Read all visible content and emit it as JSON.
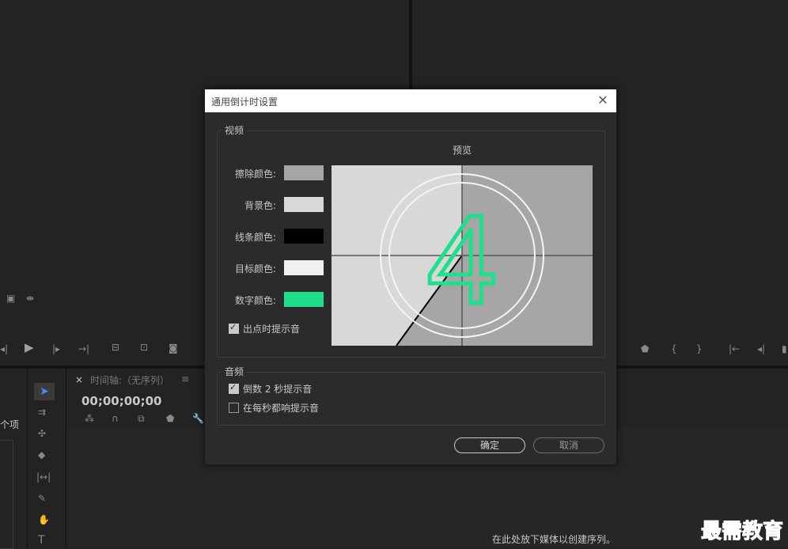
{
  "dialog": {
    "title": "通用倒计时设置",
    "video_group": "视频",
    "preview_label": "预览",
    "rows": [
      {
        "label": "擦除颜色:",
        "color": "#a6a6a6"
      },
      {
        "label": "背景色:",
        "color": "#d8d8d8"
      },
      {
        "label": "线条颜色:",
        "color": "#000000"
      },
      {
        "label": "目标颜色:",
        "color": "#f0f0f0"
      },
      {
        "label": "数字颜色:",
        "color": "#1ee08a"
      }
    ],
    "cue_at_out": "出点时提示音",
    "audio_group": "音频",
    "cue_2sec": "倒数 2 秒提示音",
    "cue_every_sec": "在每秒都响提示音",
    "ok": "确定",
    "cancel": "取消",
    "preview_number": "4"
  },
  "timeline": {
    "tab_label": "时间轴:（无序列）",
    "close_glyph": "×",
    "menu_glyph": "≡",
    "timecode": "00;00;00;00",
    "drop_hint": "在此处放下媒体以创建序列。"
  },
  "project": {
    "partial_label": "个项"
  },
  "watermark": "最需教育"
}
